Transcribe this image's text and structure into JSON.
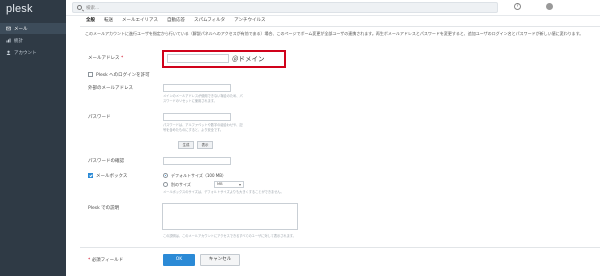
{
  "app": {
    "name": "plesk"
  },
  "sidebar": {
    "items": [
      {
        "label": "メール",
        "icon": "mail-icon",
        "active": true
      },
      {
        "label": "統計",
        "icon": "chart-icon",
        "active": false
      },
      {
        "label": "アカウント",
        "icon": "user-icon",
        "active": false
      }
    ]
  },
  "topbar": {
    "search_placeholder": "検索...",
    "help_icon": "help-icon",
    "user_icon": "user-icon"
  },
  "tabs": [
    {
      "label": "全般",
      "active": true
    },
    {
      "label": "転送",
      "active": false
    },
    {
      "label": "メールエイリアス",
      "active": false
    },
    {
      "label": "自動応答",
      "active": false
    },
    {
      "label": "スパムフィルタ",
      "active": false
    },
    {
      "label": "アンチウイルス",
      "active": false
    }
  ],
  "intro_text": "このメールアカウントに進行ユーザを指定から行いている（解説パネルへのアクセスが有効である）場合、このページでボーム変更が全部ユーザの連携されます。再生ボメールアドレスとパスワードを変更すると、追加ユーザのログイン名とパスワードが新しい値に変わります。",
  "form": {
    "email": {
      "label": "メールアドレス",
      "suffix": "＠ドメイン",
      "value": ""
    },
    "plesk_login": {
      "label": "Plesk へのログインを許可"
    },
    "external_email": {
      "label": "外部のメールアドレス",
      "hint": "メインのメールアドレスが使用できない場合のため、パスワードのリセットに使用されます。"
    },
    "password": {
      "label": "パスワード",
      "hint": "パスワードは、アルファベットや数字の組合わせや、記号を含めたものにすると、より安全です。",
      "generate_label": "生成",
      "show_label": "表示"
    },
    "password_confirm": {
      "label": "パスワードの確認"
    },
    "mailbox": {
      "label": "メールボックス",
      "option_default": "デフォルトサイズ（100 MB）",
      "option_custom": "別のサイズ",
      "custom_value": "",
      "unit": "MB",
      "hint": "メールボックスのサイズは、デフォルトサイズよりも大きくすることができません。"
    },
    "description": {
      "label": "Plesk での説明",
      "hint": "この説明は、このメールアカウントにアクセスできるすべてのユーザに対して表示されます。"
    },
    "required_note": "必須フィールド"
  },
  "buttons": {
    "ok": "OK",
    "cancel": "キャンセル"
  },
  "colors": {
    "sidebar": "#2f3a45",
    "accent": "#2b8ad6",
    "highlight": "#d0021b"
  }
}
